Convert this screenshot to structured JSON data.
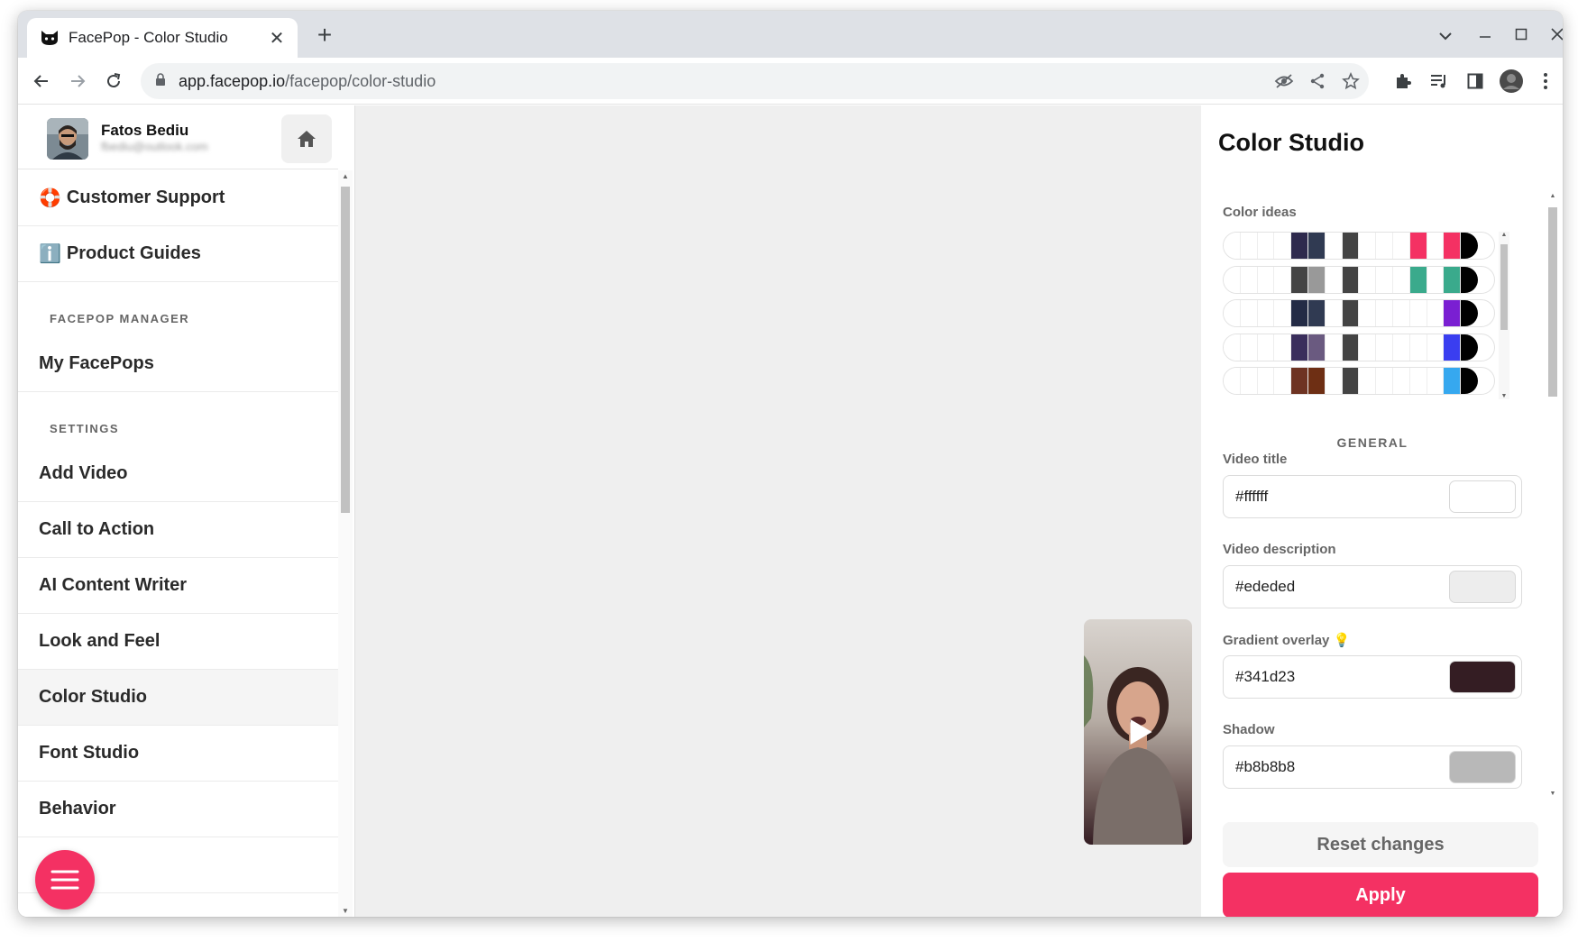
{
  "browser": {
    "tab_title": "FacePop - Color Studio",
    "url_host": "app.facepop.io",
    "url_path": "/facepop/color-studio"
  },
  "profile": {
    "name": "Fatos Bediu",
    "email": "fbediu@outlook.com"
  },
  "sidebar": {
    "support": {
      "emoji": "🛟",
      "label": "Customer Support"
    },
    "guides": {
      "emoji": "ℹ️",
      "label": "Product Guides"
    },
    "manager_heading": "FACEPOP MANAGER",
    "my_facepops": "My FacePops",
    "settings_heading": "SETTINGS",
    "items": [
      {
        "label": "Add Video"
      },
      {
        "label": "Call to Action"
      },
      {
        "label": "AI Content Writer"
      },
      {
        "label": "Look and Feel"
      },
      {
        "label": "Color Studio",
        "active": true
      },
      {
        "label": "Font Studio"
      },
      {
        "label": "Behavior"
      },
      {
        "label": ""
      }
    ]
  },
  "panel": {
    "title": "Color Studio",
    "ideas_label": "Color ideas",
    "palettes": [
      [
        "#ffffff",
        "#ffffff",
        "#ffffff",
        "#ffffff",
        "#2e2a4d",
        "#303a52",
        "#ffffff",
        "#444444",
        "#ffffff",
        "#ffffff",
        "#ffffff",
        "#f43163",
        "#ffffff",
        "#f43163",
        "#000000"
      ],
      [
        "#ffffff",
        "#ffffff",
        "#ffffff",
        "#ffffff",
        "#444444",
        "#999999",
        "#ffffff",
        "#444444",
        "#ffffff",
        "#ffffff",
        "#ffffff",
        "#3aaa8c",
        "#ffffff",
        "#3aaa8c",
        "#000000"
      ],
      [
        "#ffffff",
        "#ffffff",
        "#ffffff",
        "#ffffff",
        "#232b45",
        "#303a52",
        "#ffffff",
        "#444444",
        "#ffffff",
        "#ffffff",
        "#ffffff",
        "#ffffff",
        "#ffffff",
        "#7a1fd2",
        "#000000"
      ],
      [
        "#ffffff",
        "#ffffff",
        "#ffffff",
        "#ffffff",
        "#3a2e5c",
        "#6a5a80",
        "#ffffff",
        "#444444",
        "#ffffff",
        "#ffffff",
        "#ffffff",
        "#ffffff",
        "#ffffff",
        "#3a3ef0",
        "#000000"
      ],
      [
        "#ffffff",
        "#ffffff",
        "#ffffff",
        "#ffffff",
        "#6e3322",
        "#6e2f14",
        "#ffffff",
        "#444444",
        "#ffffff",
        "#ffffff",
        "#ffffff",
        "#ffffff",
        "#ffffff",
        "#36a8ef",
        "#000000"
      ]
    ],
    "section_label": "GENERAL",
    "fields": [
      {
        "label": "Video title",
        "value": "#ffffff",
        "color": "#ffffff"
      },
      {
        "label": "Video description",
        "value": "#ededed",
        "color": "#ededed"
      },
      {
        "label": "Gradient overlay 💡",
        "value": "#341d23",
        "color": "#341d23"
      },
      {
        "label": "Shadow",
        "value": "#b8b8b8",
        "color": "#b8b8b8"
      }
    ],
    "reset_label": "Reset changes",
    "apply_label": "Apply"
  }
}
